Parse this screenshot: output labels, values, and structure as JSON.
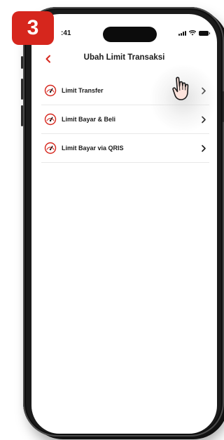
{
  "step": {
    "number": "3"
  },
  "status_bar": {
    "time": ":41"
  },
  "header": {
    "title": "Ubah Limit Transaksi",
    "back_icon": "chevron-left-icon"
  },
  "menu": {
    "items": [
      {
        "label": "Limit Transfer",
        "icon": "speedometer-icon"
      },
      {
        "label": "Limit Bayar & Beli",
        "icon": "speedometer-icon"
      },
      {
        "label": "Limit Bayar via QRIS",
        "icon": "speedometer-icon"
      }
    ]
  },
  "colors": {
    "accent": "#d6261d",
    "text": "#1a1a1a",
    "divider": "#e8e8e8"
  }
}
